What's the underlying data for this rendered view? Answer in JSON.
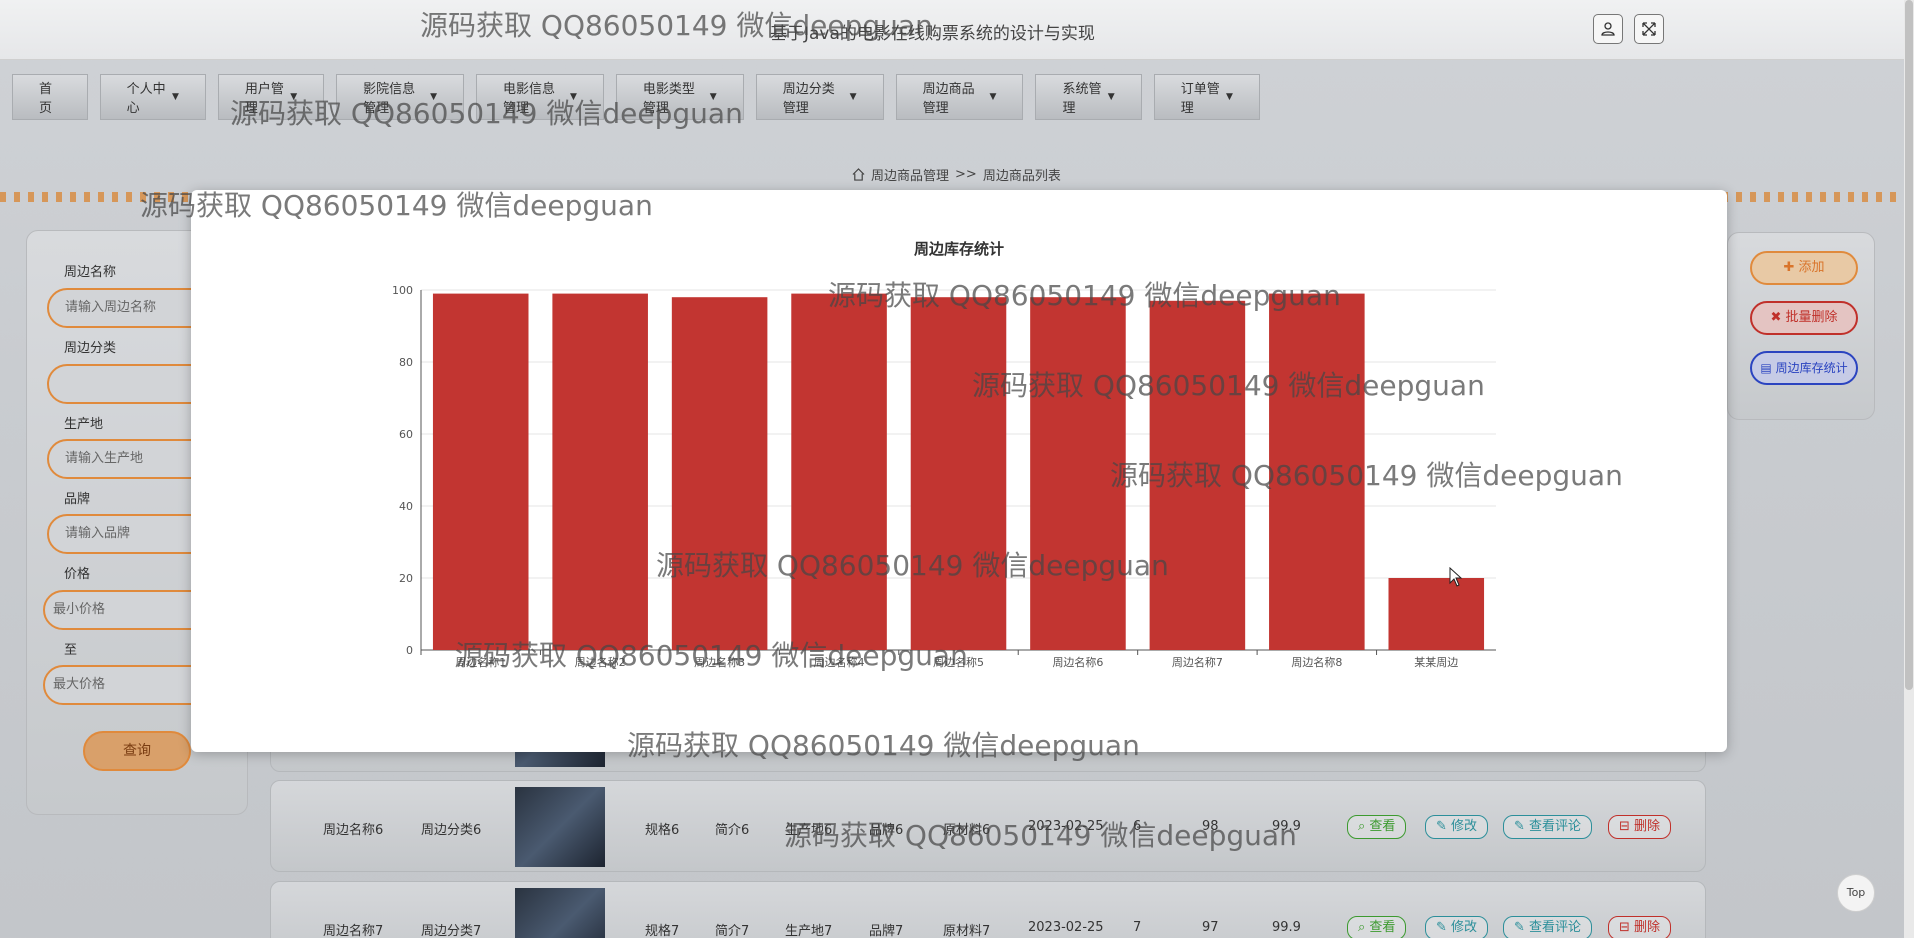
{
  "header": {
    "system_title": "基于Java的电影在线购票系统的设计与实现",
    "user_icon": "user-icon",
    "fullscreen_icon": "fullscreen-icon"
  },
  "nav": {
    "items": [
      {
        "label": "首页",
        "has_dropdown": false
      },
      {
        "label": "个人中心",
        "has_dropdown": true
      },
      {
        "label": "用户管理",
        "has_dropdown": true
      },
      {
        "label": "影院信息管理",
        "has_dropdown": true
      },
      {
        "label": "电影信息管理",
        "has_dropdown": true
      },
      {
        "label": "电影类型管理",
        "has_dropdown": true
      },
      {
        "label": "周边分类管理",
        "has_dropdown": true
      },
      {
        "label": "周边商品管理",
        "has_dropdown": true
      },
      {
        "label": "系统管理",
        "has_dropdown": true
      },
      {
        "label": "订单管理",
        "has_dropdown": true
      }
    ]
  },
  "breadcrumb": {
    "home_icon": "home-icon",
    "section": "周边商品管理",
    "separator": ">>",
    "page": "周边商品列表"
  },
  "search": {
    "name_label": "周边名称",
    "name_placeholder": "请输入周边名称",
    "category_label": "周边分类",
    "category_value": "",
    "origin_label": "生产地",
    "origin_placeholder": "请输入生产地",
    "brand_label": "品牌",
    "brand_placeholder": "请输入品牌",
    "price_label": "价格",
    "min_price_placeholder": "最小价格",
    "to_label": "至",
    "max_price_placeholder": "最大价格",
    "query_button": "查询"
  },
  "actions": {
    "add": "添加",
    "batch_delete": "批量删除",
    "stock_stats": "周边库存统计"
  },
  "table_rows": [
    {
      "name": "周边名称6",
      "category": "周边分类6",
      "spec": "规格6",
      "intro": "简介6",
      "origin": "生产地6",
      "brand": "品牌6",
      "material": "原材料6",
      "date": "2023-02-25",
      "col_a": "6",
      "col_b": "98",
      "col_c": "99.9"
    },
    {
      "name": "周边名称7",
      "category": "周边分类7",
      "spec": "规格7",
      "intro": "简介7",
      "origin": "生产地7",
      "brand": "品牌7",
      "material": "原材料7",
      "date": "2023-02-25",
      "col_a": "7",
      "col_b": "97",
      "col_c": "99.9"
    }
  ],
  "row_buttons": {
    "view": "查看",
    "edit": "修改",
    "review": "查看评论",
    "delete": "删除"
  },
  "chart_data": {
    "type": "bar",
    "title": "周边库存统计",
    "categories": [
      "周边名称1",
      "周边名称2",
      "周边名称3",
      "周边名称4",
      "周边名称5",
      "周边名称6",
      "周边名称7",
      "周边名称8",
      "某某周边"
    ],
    "values": [
      99,
      99,
      98,
      99,
      98,
      98,
      97,
      99,
      20
    ],
    "ylim": [
      0,
      100
    ],
    "yticks": [
      0,
      20,
      40,
      60,
      80,
      100
    ],
    "xlabel": "",
    "ylabel": "",
    "grid": true,
    "bar_color": "#c23531"
  },
  "watermark": "源码获取 QQ86050149 微信deepguan",
  "top_button": "Top"
}
